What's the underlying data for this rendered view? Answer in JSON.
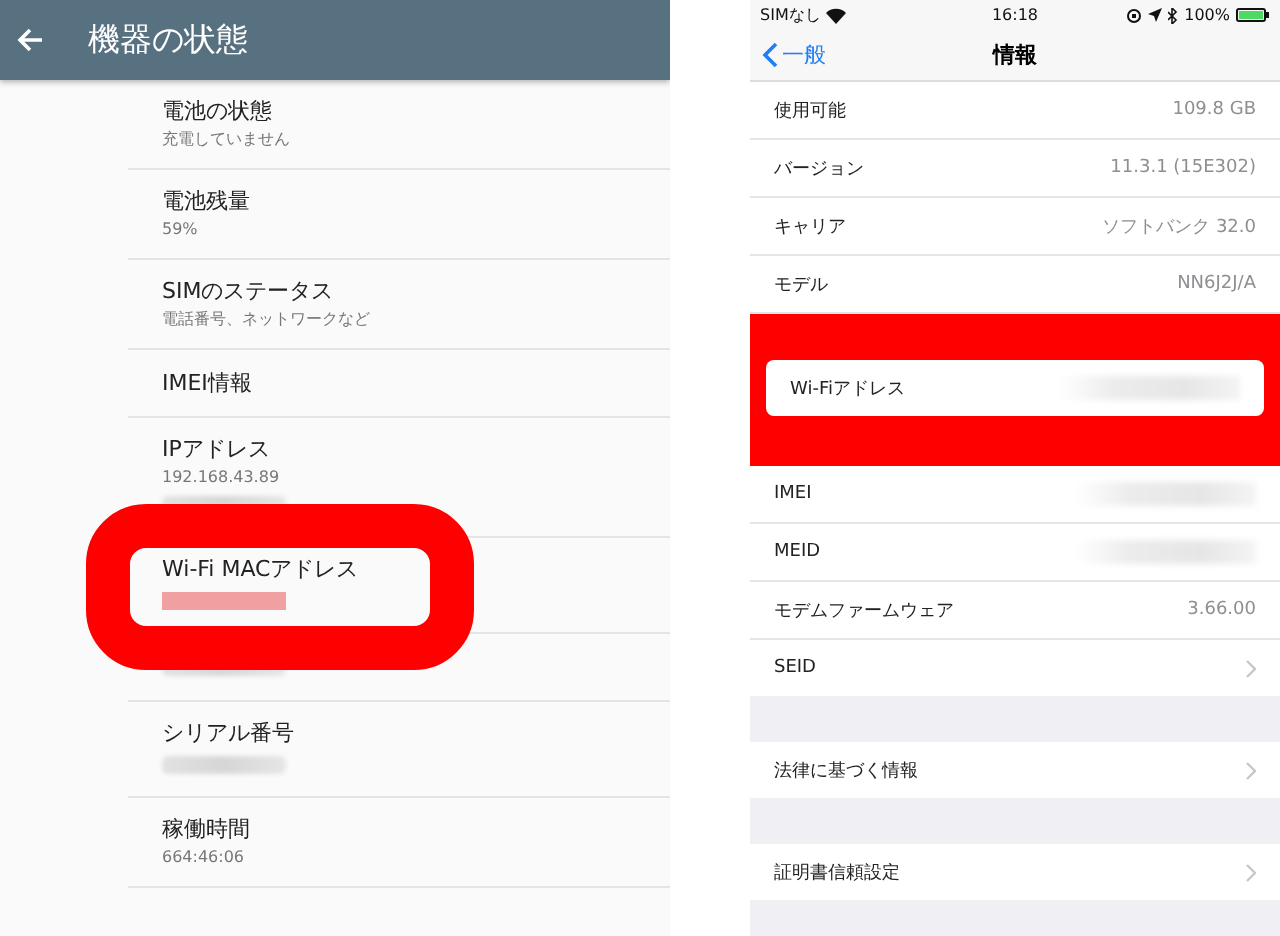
{
  "android": {
    "title": "機器の状態",
    "items": [
      {
        "title": "電池の状態",
        "lines": [
          {
            "kind": "text",
            "text": "充電していません"
          }
        ],
        "highlighted": false
      },
      {
        "title": "電池残量",
        "lines": [
          {
            "kind": "text",
            "text": "59%"
          }
        ],
        "highlighted": false
      },
      {
        "title": "SIMのステータス",
        "lines": [
          {
            "kind": "text",
            "text": "電話番号、ネットワークなど"
          }
        ],
        "highlighted": false
      },
      {
        "title": "IMEI情報",
        "highlighted": false
      },
      {
        "title": "IPアドレス",
        "lines": [
          {
            "kind": "text",
            "text": "192.168.43.89"
          },
          {
            "kind": "blurred"
          }
        ],
        "highlighted": false
      },
      {
        "title": "Wi-Fi MACアドレス",
        "lines": [
          {
            "kind": "blurred"
          }
        ],
        "highlighted": true
      },
      {
        "lines": [
          {
            "kind": "blurred"
          }
        ],
        "highlighted": false
      },
      {
        "title": "シリアル番号",
        "lines": [
          {
            "kind": "blurred"
          }
        ],
        "highlighted": false
      },
      {
        "title": "稼働時間",
        "lines": [
          {
            "kind": "text",
            "text": "664:46:06"
          }
        ],
        "highlighted": false
      }
    ]
  },
  "ios": {
    "status_bar": {
      "carrier": "SIMなし",
      "time": "16:18",
      "battery": "100%"
    },
    "nav": {
      "back": "一般",
      "title": "情報"
    },
    "groups": [
      {
        "rows": [
          {
            "label": "使用可能",
            "kind": "value",
            "value": "109.8 GB",
            "highlighted": false
          },
          {
            "label": "バージョン",
            "kind": "value",
            "value": "11.3.1 (15E302)",
            "highlighted": false
          },
          {
            "label": "キャリア",
            "kind": "value",
            "value": "ソフトバンク 32.0",
            "highlighted": false
          },
          {
            "label": "モデル",
            "kind": "value",
            "value": "NN6J2J/A",
            "highlighted": false
          },
          {
            "label": "Wi-Fiアドレス",
            "kind": "blurred",
            "highlighted": true
          },
          {
            "label": "IMEI",
            "kind": "blurred",
            "highlighted": false
          },
          {
            "label": "MEID",
            "kind": "blurred",
            "highlighted": false
          },
          {
            "label": "モデムファームウェア",
            "kind": "value",
            "value": "3.66.00",
            "highlighted": false
          },
          {
            "label": "SEID",
            "kind": "chevron",
            "highlighted": false
          }
        ]
      },
      {
        "rows": [
          {
            "label": "法律に基づく情報",
            "kind": "chevron",
            "highlighted": false
          }
        ]
      },
      {
        "rows": [
          {
            "label": "証明書信頼設定",
            "kind": "chevron",
            "highlighted": false
          }
        ]
      }
    ]
  }
}
